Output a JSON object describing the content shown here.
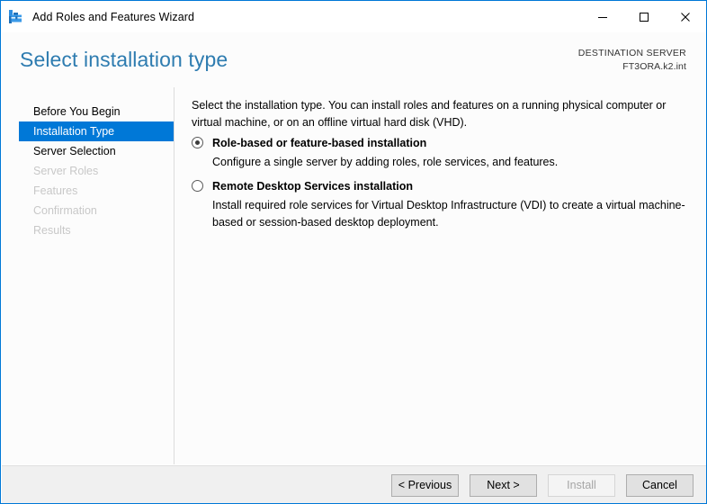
{
  "window": {
    "title": "Add Roles and Features Wizard",
    "icon": "roles-features-toolbox-icon",
    "accent_color": "#0078d7",
    "controls": {
      "minimize": "minimize-icon",
      "maximize": "maximize-icon",
      "close": "close-icon"
    }
  },
  "header": {
    "page_title": "Select installation type",
    "destination_label": "DESTINATION SERVER",
    "destination_server": "FT3ORA.k2.int",
    "title_color": "#2e7cb0"
  },
  "sidebar": {
    "items": [
      {
        "label": "Before You Begin",
        "state": "enabled"
      },
      {
        "label": "Installation Type",
        "state": "selected"
      },
      {
        "label": "Server Selection",
        "state": "enabled"
      },
      {
        "label": "Server Roles",
        "state": "disabled"
      },
      {
        "label": "Features",
        "state": "disabled"
      },
      {
        "label": "Confirmation",
        "state": "disabled"
      },
      {
        "label": "Results",
        "state": "disabled"
      }
    ],
    "selected_bg": "#0078d7"
  },
  "main": {
    "intro": "Select the installation type. You can install roles and features on a running physical computer or virtual machine, or on an offline virtual hard disk (VHD).",
    "options": [
      {
        "label": "Role-based or feature-based installation",
        "description": "Configure a single server by adding roles, role services, and features.",
        "selected": true
      },
      {
        "label": "Remote Desktop Services installation",
        "description": "Install required role services for Virtual Desktop Infrastructure (VDI) to create a virtual machine-based or session-based desktop deployment.",
        "selected": false
      }
    ]
  },
  "footer": {
    "buttons": [
      {
        "label": "< Previous",
        "enabled": true
      },
      {
        "label": "Next >",
        "enabled": true
      },
      {
        "label": "Install",
        "enabled": false
      },
      {
        "label": "Cancel",
        "enabled": true
      }
    ]
  }
}
